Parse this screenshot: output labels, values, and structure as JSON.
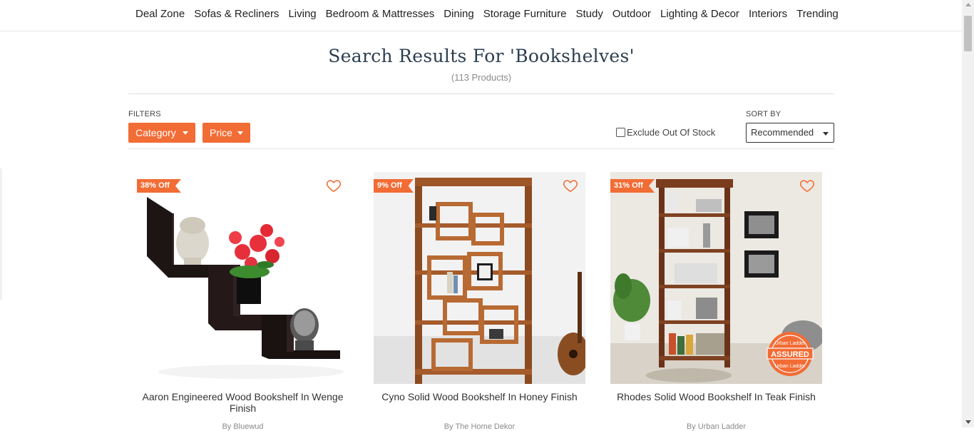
{
  "nav": {
    "items": [
      "Deal Zone",
      "Sofas & Recliners",
      "Living",
      "Bedroom & Mattresses",
      "Dining",
      "Storage Furniture",
      "Study",
      "Outdoor",
      "Lighting & Decor",
      "Interiors",
      "Trending"
    ]
  },
  "header": {
    "title": "Search Results For 'Bookshelves'",
    "count": "(113 Products)"
  },
  "filters": {
    "label": "FILTERS",
    "category": "Category",
    "price": "Price",
    "exclude_out_of_stock": "Exclude Out Of Stock",
    "exclude_checked": false
  },
  "sort": {
    "label": "SORT BY",
    "selected": "Recommended"
  },
  "products": [
    {
      "discount": "38% Off",
      "name": "Aaron Engineered Wood Bookshelf In Wenge Finish",
      "brand": "By Bluewud"
    },
    {
      "discount": "9% Off",
      "name": "Cyno Solid Wood Bookshelf In Honey Finish",
      "brand": "By The Home Dekor"
    },
    {
      "discount": "31% Off",
      "name": "Rhodes Solid Wood Bookshelf In Teak Finish",
      "brand": "By Urban Ladder"
    }
  ],
  "assured_badge": {
    "text": "ASSURED",
    "ring": "Urban Ladder"
  },
  "colors": {
    "accent": "#f26c35",
    "title": "#2c3e50"
  }
}
